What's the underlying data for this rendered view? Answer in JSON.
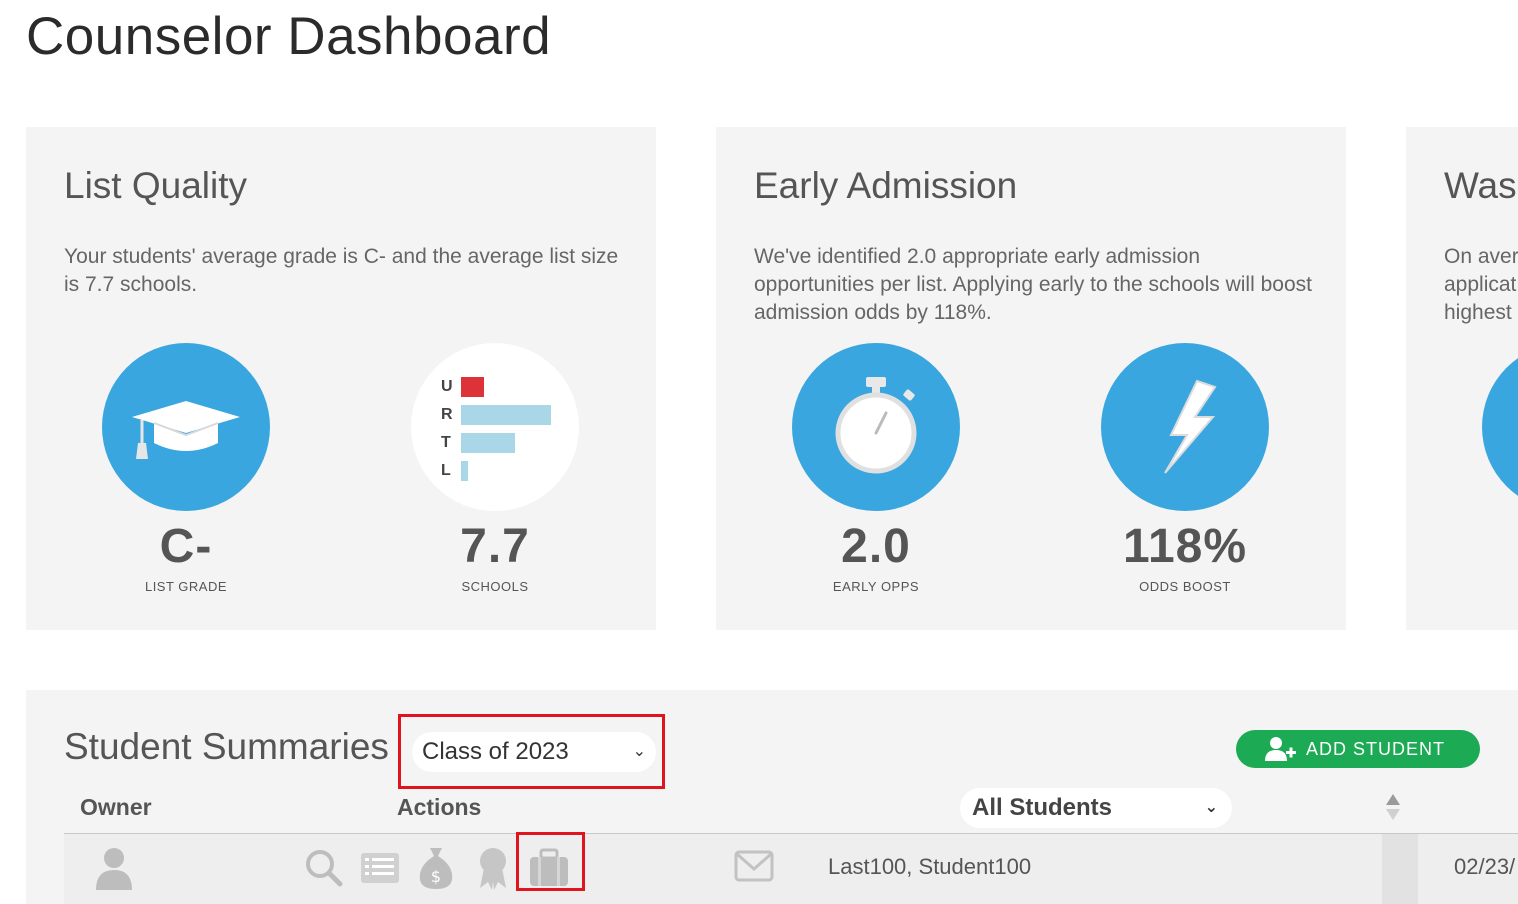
{
  "page": {
    "title": "Counselor Dashboard"
  },
  "cards": {
    "list_quality": {
      "title": "List Quality",
      "description": "Your students' average grade is C- and the average list size is 7.7 schools.",
      "grade": {
        "value": "C-",
        "label": "LIST GRADE",
        "icon": "graduation-cap-icon"
      },
      "schools": {
        "value": "7.7",
        "label": "SCHOOLS",
        "bars": [
          {
            "letter": "U",
            "share": 0.25,
            "color": "#dd3338"
          },
          {
            "letter": "R",
            "share": 1.0,
            "color": "#a9d7e8"
          },
          {
            "letter": "T",
            "share": 0.6,
            "color": "#a9d7e8"
          },
          {
            "letter": "L",
            "share": 0.08,
            "color": "#a9d7e8"
          }
        ]
      }
    },
    "early_admission": {
      "title": "Early Admission",
      "description": "We've identified 2.0 appropriate early admission opportunities per list. Applying early to the schools will boost admission odds by 118%.",
      "early_opps": {
        "value": "2.0",
        "label": "EARLY OPPS",
        "icon": "stopwatch-icon"
      },
      "odds_boost": {
        "value": "118%",
        "label": "ODDS BOOST",
        "icon": "lightning-icon"
      }
    },
    "third": {
      "title": "Was",
      "description_lines": [
        "On avera",
        "applicat",
        "highest"
      ]
    }
  },
  "summary": {
    "title": "Student Summaries",
    "class_select": "Class of 2023",
    "add_student": "ADD STUDENT",
    "columns": {
      "owner": "Owner",
      "actions": "Actions"
    },
    "filter_select": "All Students",
    "rows": [
      {
        "name": "Last100, Student100",
        "date": "02/23/"
      }
    ]
  },
  "colors": {
    "accent_blue": "#3aa6df",
    "green": "#1daa55",
    "highlight_red": "#e0141e"
  }
}
